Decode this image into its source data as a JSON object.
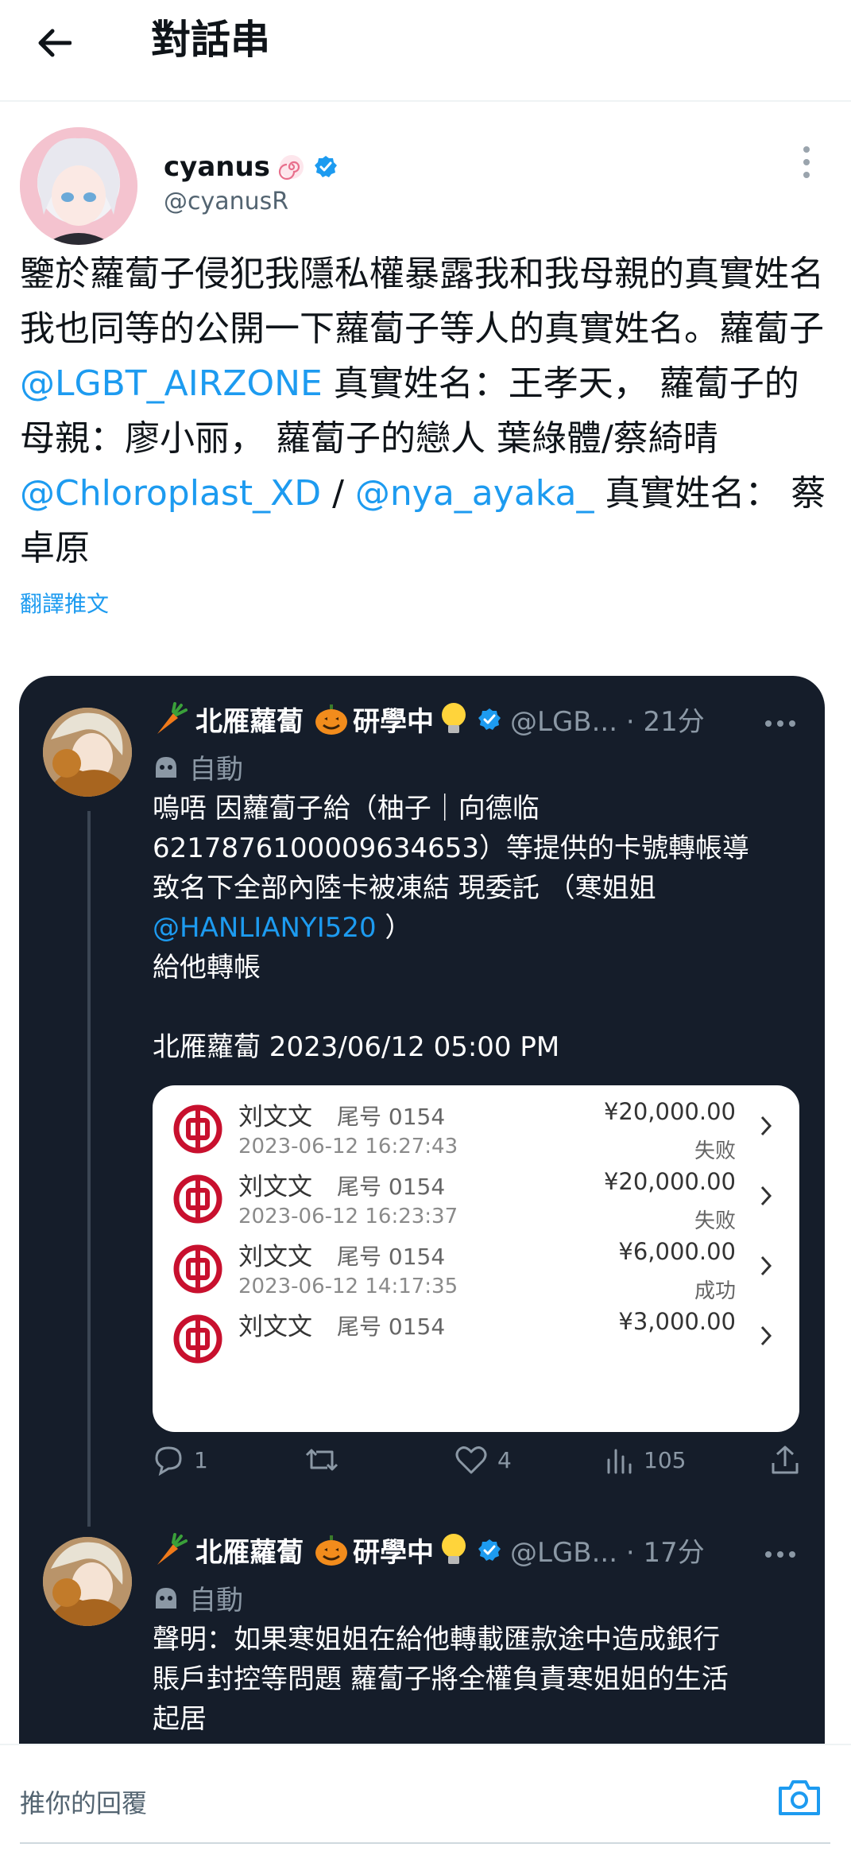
{
  "header": {
    "title": "對話串",
    "back_icon": "arrow-left-icon"
  },
  "main_tweet": {
    "display_name": "cyanus",
    "handle": "@cyanusR",
    "text_segments": [
      {
        "t": "鑒於蘿蔔子侵犯我隱私權暴露我和我母親的真實姓名我也同等的公開一下蘿蔔子等人的真實姓名。蘿蔔子 ",
        "link": false
      },
      {
        "t": "@LGBT_AIRZONE",
        "link": true
      },
      {
        "t": "  真實姓名：王孝天， 蘿蔔子的母親：廖小丽， 蘿蔔子的戀人 葉綠體/蔡綺晴 ",
        "link": false
      },
      {
        "t": "@Chloroplast_XD",
        "link": true
      },
      {
        "t": " / ",
        "link": false
      },
      {
        "t": "@nya_ayaka_",
        "link": true
      },
      {
        "t": "  真實姓名：  蔡卓原",
        "link": false
      }
    ],
    "translate_label": "翻譯推文"
  },
  "thread": {
    "post1": {
      "display_name": "北雁蘿蔔",
      "suffix": "研學中",
      "handle_meta": "@LGB... · 21分",
      "automated_label": "自動",
      "text_line1": "嗚唔 因蘿蔔子給（柚子｜向德临",
      "text_line2": "6217876100009634653）等提供的卡號轉帳導",
      "text_line3": "致名下全部內陸卡被凍結 現委託 （寒姐姐",
      "mention": "@HANLIANYI520",
      "mention_tail": " ）",
      "text_line5": "給他轉帳",
      "signature": "北雁蘿蔔 2023/06/12 05:00 PM",
      "transactions": [
        {
          "name": "刘文文",
          "tail": "尾号 0154",
          "time": "2023-06-12 16:27:43",
          "amount": "¥20,000.00",
          "status": "失败"
        },
        {
          "name": "刘文文",
          "tail": "尾号 0154",
          "time": "2023-06-12 16:23:37",
          "amount": "¥20,000.00",
          "status": "失败"
        },
        {
          "name": "刘文文",
          "tail": "尾号 0154",
          "time": "2023-06-12 14:17:35",
          "amount": "¥6,000.00",
          "status": "成功"
        },
        {
          "name": "刘文文",
          "tail": "尾号 0154",
          "time": "",
          "amount": "¥3,000.00",
          "status": ""
        }
      ],
      "replies": "1",
      "retweets": "",
      "likes": "4",
      "views": "105"
    },
    "post2": {
      "display_name": "北雁蘿蔔",
      "suffix": "研學中",
      "handle_meta": "@LGB... · 17分",
      "automated_label": "自動",
      "text_line1": "聲明：如果寒姐姐在給他轉載匯款途中造成銀行",
      "text_line2": "賬戶封控等問題 蘿蔔子將全權負責寒姐姐的生活",
      "text_line3": "起居"
    }
  },
  "reply_bar": {
    "placeholder": "推你的回覆",
    "camera_icon": "camera-icon"
  },
  "colors": {
    "link": "#1d9bf0",
    "card_bg": "#151d2a",
    "bank_red": "#c8102e",
    "verified": "#1d9bf0"
  }
}
